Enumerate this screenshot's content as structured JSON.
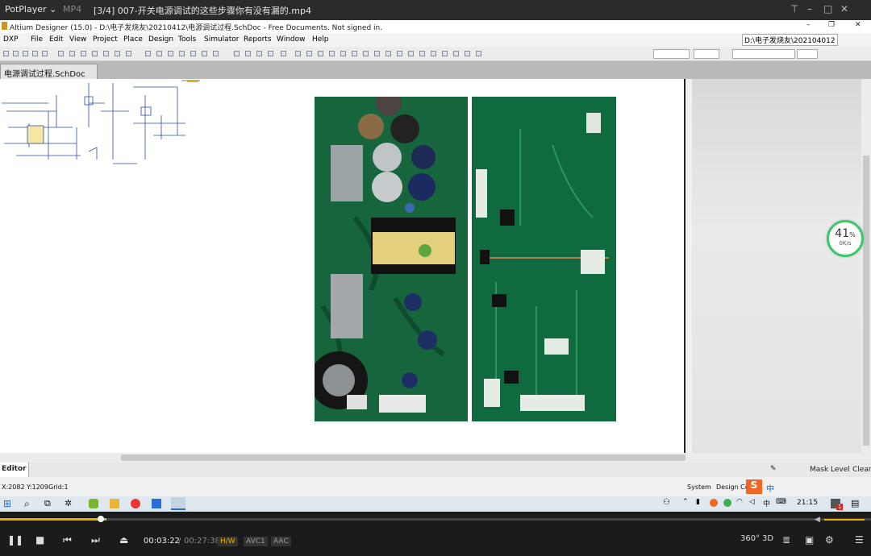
{
  "player": {
    "name": "PotPlayer",
    "format": "MP4",
    "title": "[3/4] 007-开关电源调试的这些步骤你有没有漏的.mp4",
    "current_time": "00:03:22",
    "separator": "/",
    "total_time": "00:27:38",
    "tag_hw": "H/W",
    "tag_video": "AVC1",
    "tag_audio": "AAC",
    "progress": 0.122,
    "accent": "#e6b000"
  },
  "app": {
    "title": "Altium Designer (15.0) - D:\\电子发烧友\\20210412\\电源调试过程.SchDoc - Free Documents. Not signed in.",
    "menu": [
      "DXP",
      "File",
      "Edit",
      "View",
      "Project",
      "Place",
      "Design",
      "Tools",
      "Simulator",
      "Reports",
      "Window",
      "Help"
    ],
    "path_box": "D:\\电子发烧友\\202104012",
    "doc_tab": "电源调试过程.SchDoc",
    "editor_tab": "Editor",
    "mask_level": "Mask Level",
    "clear": "Clear",
    "coords": "X:2082 Y:1209",
    "grid": "Grid:1",
    "status_system": "System",
    "status_design": "Design Co"
  },
  "speed_widget": {
    "percent": "41",
    "unit": "%",
    "rate": "0K/s"
  },
  "taskbar": {
    "time": "21:15",
    "ime": "中",
    "badge": "1"
  }
}
